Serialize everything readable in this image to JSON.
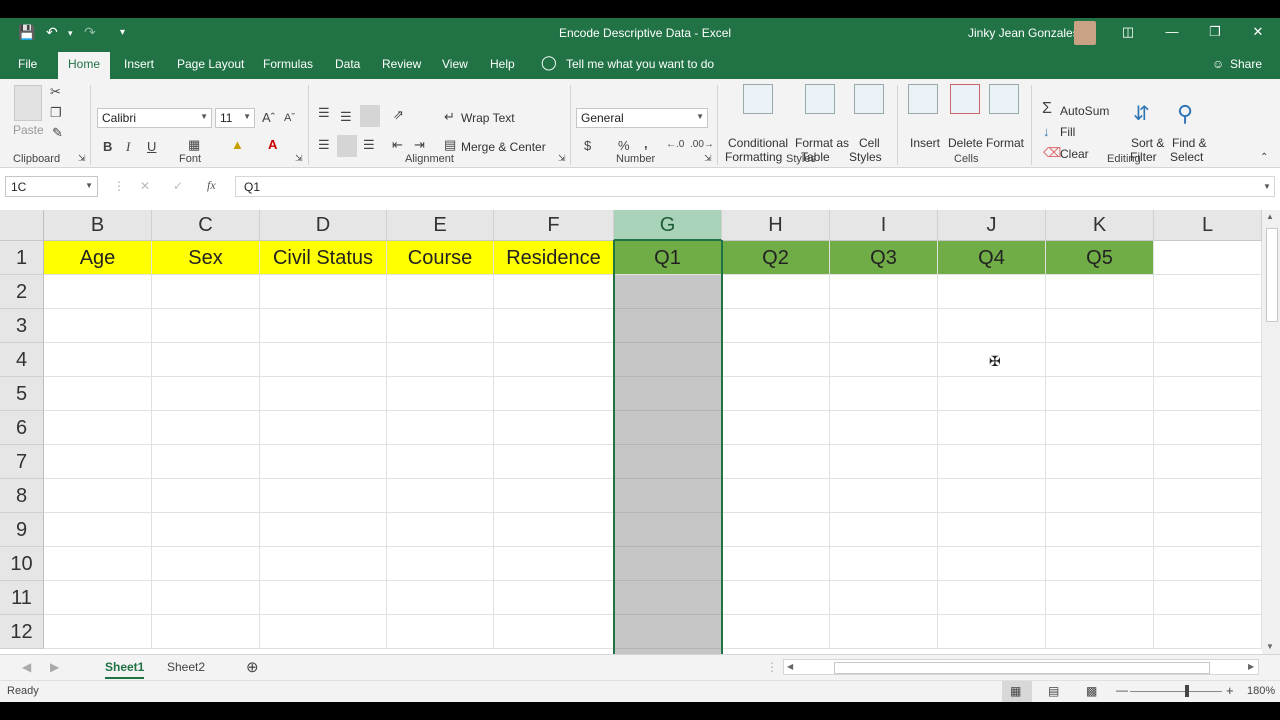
{
  "window": {
    "title": "Encode Descriptive Data  -  Excel",
    "user": "Jinky Jean Gonzales"
  },
  "menu": {
    "tabs": [
      "File",
      "Home",
      "Insert",
      "Page Layout",
      "Formulas",
      "Data",
      "Review",
      "View",
      "Help"
    ],
    "tell_me": "Tell me what you want to do",
    "share": "Share"
  },
  "ribbon": {
    "clipboard": {
      "paste": "Paste",
      "label": "Clipboard"
    },
    "font": {
      "name": "Calibri",
      "size": "11",
      "bold": "B",
      "italic": "I",
      "underline": "U",
      "label": "Font"
    },
    "alignment": {
      "wrap": "Wrap Text",
      "merge": "Merge & Center",
      "label": "Alignment"
    },
    "number": {
      "format": "General",
      "currency": "$",
      "percent": "%",
      "comma": ",",
      "label": "Number"
    },
    "styles": {
      "conditional_1": "Conditional",
      "conditional_2": "Formatting",
      "format_table_1": "Format as",
      "format_table_2": "Table",
      "cell_styles_1": "Cell",
      "cell_styles_2": "Styles",
      "label": "Styles"
    },
    "cells": {
      "insert": "Insert",
      "delete": "Delete",
      "format": "Format",
      "label": "Cells"
    },
    "editing": {
      "autosum": "AutoSum",
      "fill": "Fill",
      "clear": "Clear",
      "sort_1": "Sort &",
      "sort_2": "Filter",
      "find_1": "Find &",
      "find_2": "Select",
      "label": "Editing"
    }
  },
  "formula_bar": {
    "name_box": "1C",
    "fx": "fx",
    "content": "Q1"
  },
  "grid": {
    "columns": [
      "B",
      "C",
      "D",
      "E",
      "F",
      "G",
      "H",
      "I",
      "J",
      "K",
      "L"
    ],
    "rows": [
      "1",
      "2",
      "3",
      "4",
      "5",
      "6",
      "7",
      "8",
      "9",
      "10",
      "11",
      "12"
    ],
    "row1": [
      "Age",
      "Sex",
      "Civil Status",
      "Course",
      "Residence",
      "Q1",
      "Q2",
      "Q3",
      "Q4",
      "Q5",
      ""
    ],
    "selected_column": "G",
    "header_colors": {
      "demographic": "#ffff00",
      "questions": "#70ad47"
    }
  },
  "sheets": {
    "tabs": [
      "Sheet1",
      "Sheet2"
    ],
    "active": "Sheet1"
  },
  "status": {
    "ready": "Ready",
    "zoom": "180%"
  }
}
